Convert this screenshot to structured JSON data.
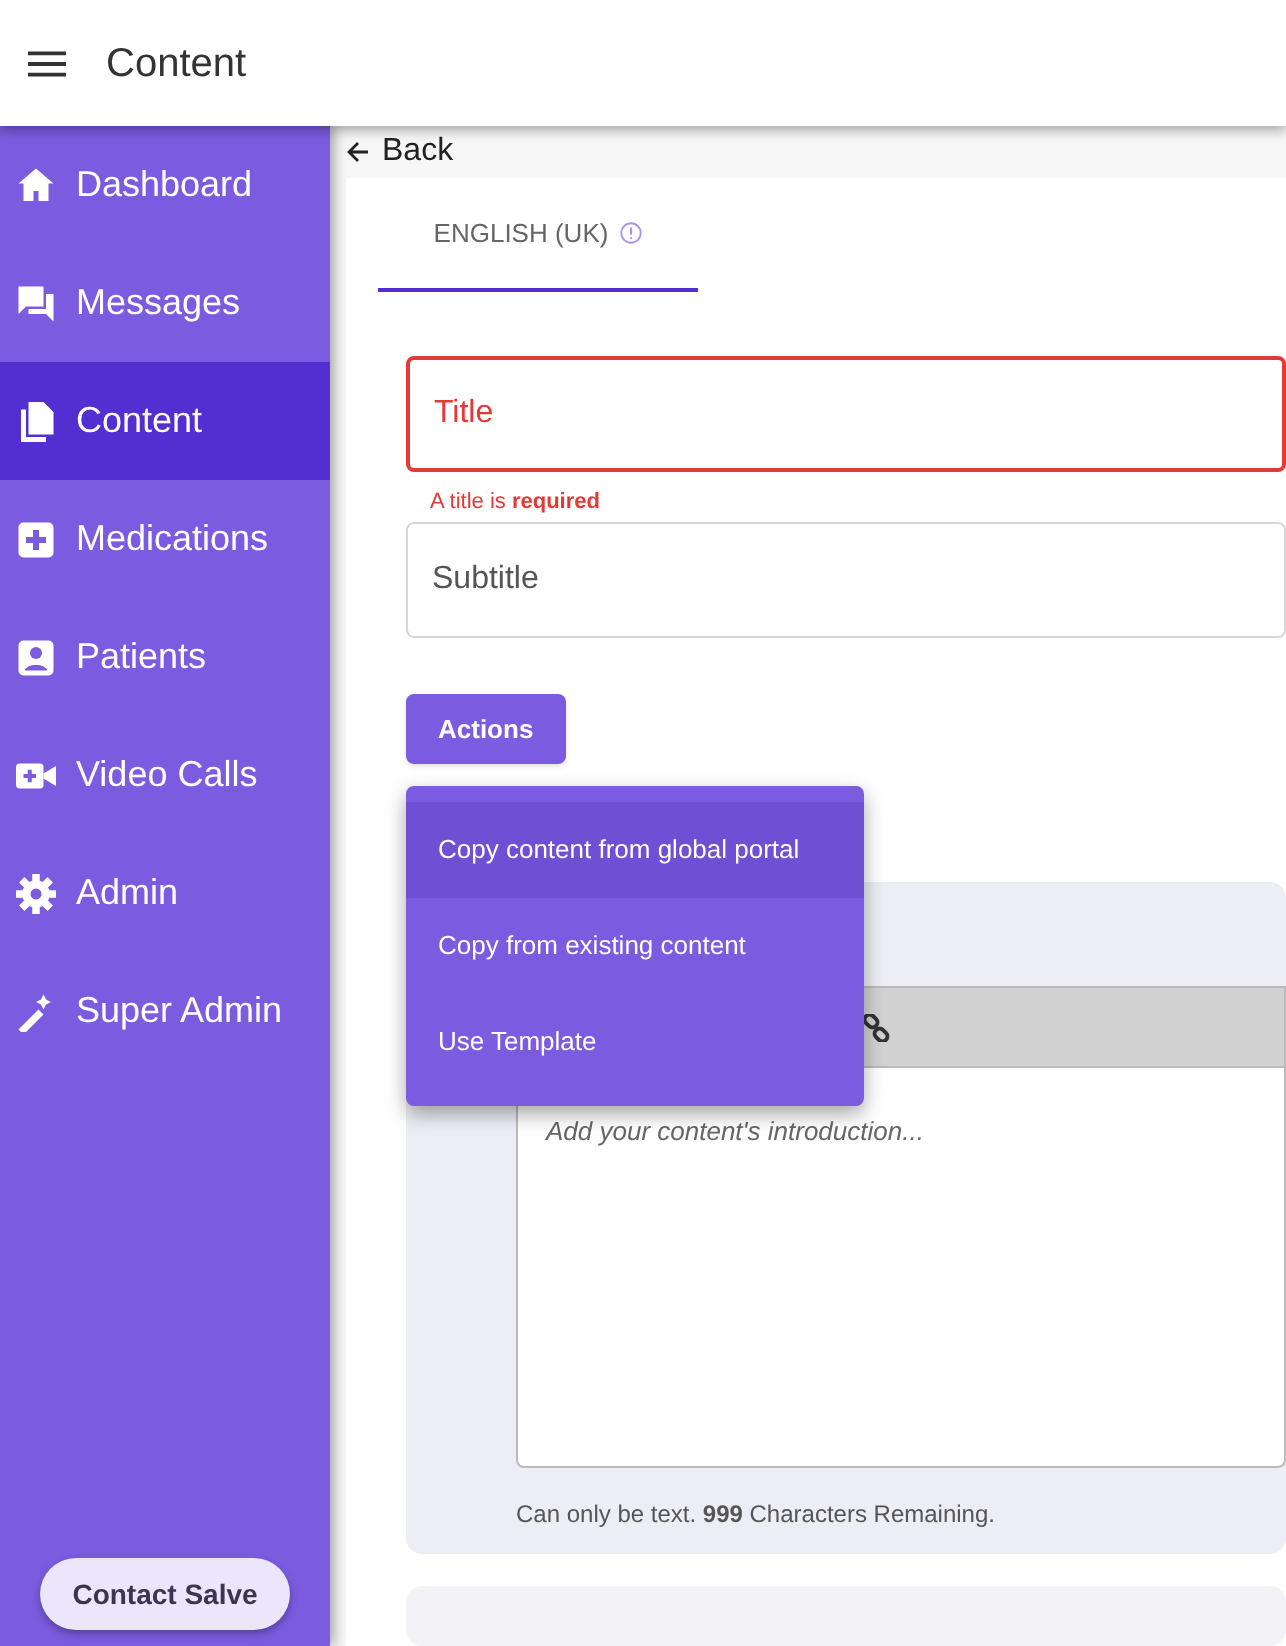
{
  "app_bar": {
    "title": "Content"
  },
  "sidebar": {
    "items": [
      {
        "label": "Dashboard",
        "selected": false
      },
      {
        "label": "Messages",
        "selected": false
      },
      {
        "label": "Content",
        "selected": true
      },
      {
        "label": "Medications",
        "selected": false
      },
      {
        "label": "Patients",
        "selected": false
      },
      {
        "label": "Video Calls",
        "selected": false
      },
      {
        "label": "Admin",
        "selected": false
      },
      {
        "label": "Super Admin",
        "selected": false
      }
    ],
    "contact_button": "Contact Salve"
  },
  "back_link": "Back",
  "tabs": [
    {
      "label": "ENGLISH (UK)",
      "selected": true,
      "warning": true
    }
  ],
  "title_field": {
    "placeholder": "Title",
    "error": true,
    "error_text": "A title is **required**"
  },
  "subtitle_field": {
    "placeholder": "Subtitle"
  },
  "actions_button": "Actions",
  "actions_menu": {
    "items": [
      {
        "label": "Copy content from global portal",
        "highlighted": true
      },
      {
        "label": "Copy from existing content",
        "highlighted": false
      },
      {
        "label": "Use Template",
        "highlighted": false
      }
    ]
  },
  "introduction": {
    "placeholder": "Add your content's introduction...",
    "helper": "Can only be text. **999** Characters Remaining."
  }
}
